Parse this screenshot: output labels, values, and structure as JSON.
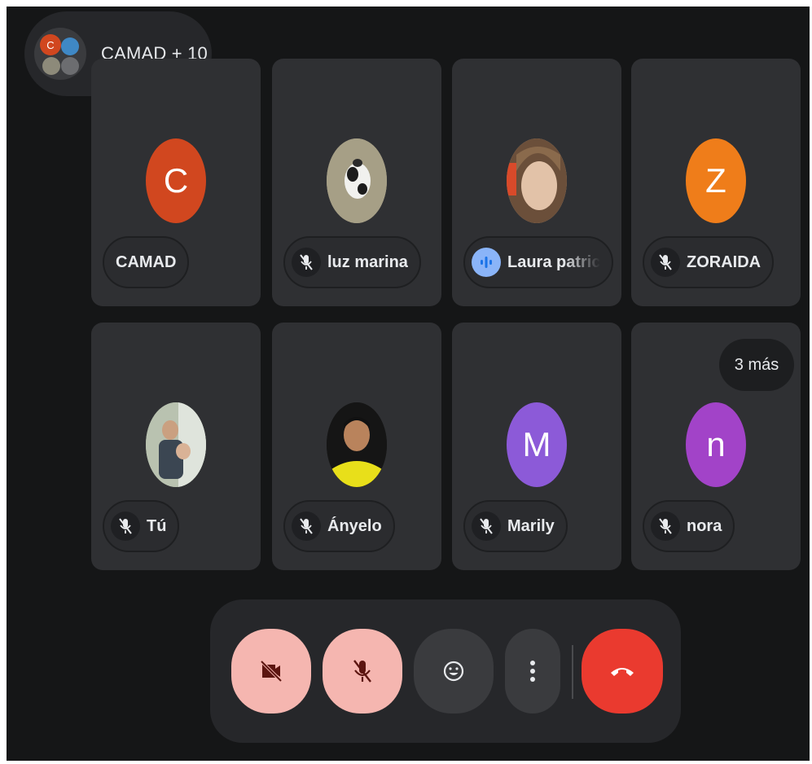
{
  "meeting": {
    "group_label": "CAMAD + 10",
    "group_initial": "C"
  },
  "participants": [
    {
      "name": "CAMAD",
      "initial": "C",
      "avatar_color": "#d1471f",
      "mic": "none"
    },
    {
      "name": "luz marina",
      "initial": "",
      "avatar_color": "#a19a82",
      "mic": "muted"
    },
    {
      "name": "Laura patric",
      "initial": "",
      "avatar_color": "#c9a07c",
      "mic": "speaking"
    },
    {
      "name": "ZORAIDA",
      "initial": "Z",
      "avatar_color": "#ef7d1a",
      "mic": "muted"
    },
    {
      "name": "Tú",
      "initial": "",
      "avatar_color": "#9fae9a",
      "mic": "muted"
    },
    {
      "name": "Ányelo",
      "initial": "",
      "avatar_color": "#1a1a1a",
      "mic": "muted"
    },
    {
      "name": "Marily",
      "initial": "M",
      "avatar_color": "#8c5ad8",
      "mic": "muted"
    },
    {
      "name": "nora",
      "initial": "n",
      "avatar_color": "#a243c8",
      "mic": "muted"
    }
  ],
  "more_badge": "3 más",
  "controls": {
    "camera": "camera-off-icon",
    "mic": "mic-off-icon",
    "reactions": "emoji-icon",
    "more": "more-vertical-icon",
    "hangup": "hangup-icon"
  },
  "colors": {
    "background": "#151617",
    "tile": "#2f3033",
    "muted_button": "#f5b6b0",
    "hangup": "#ea3a2f",
    "speaking": "#8ab4f8"
  }
}
